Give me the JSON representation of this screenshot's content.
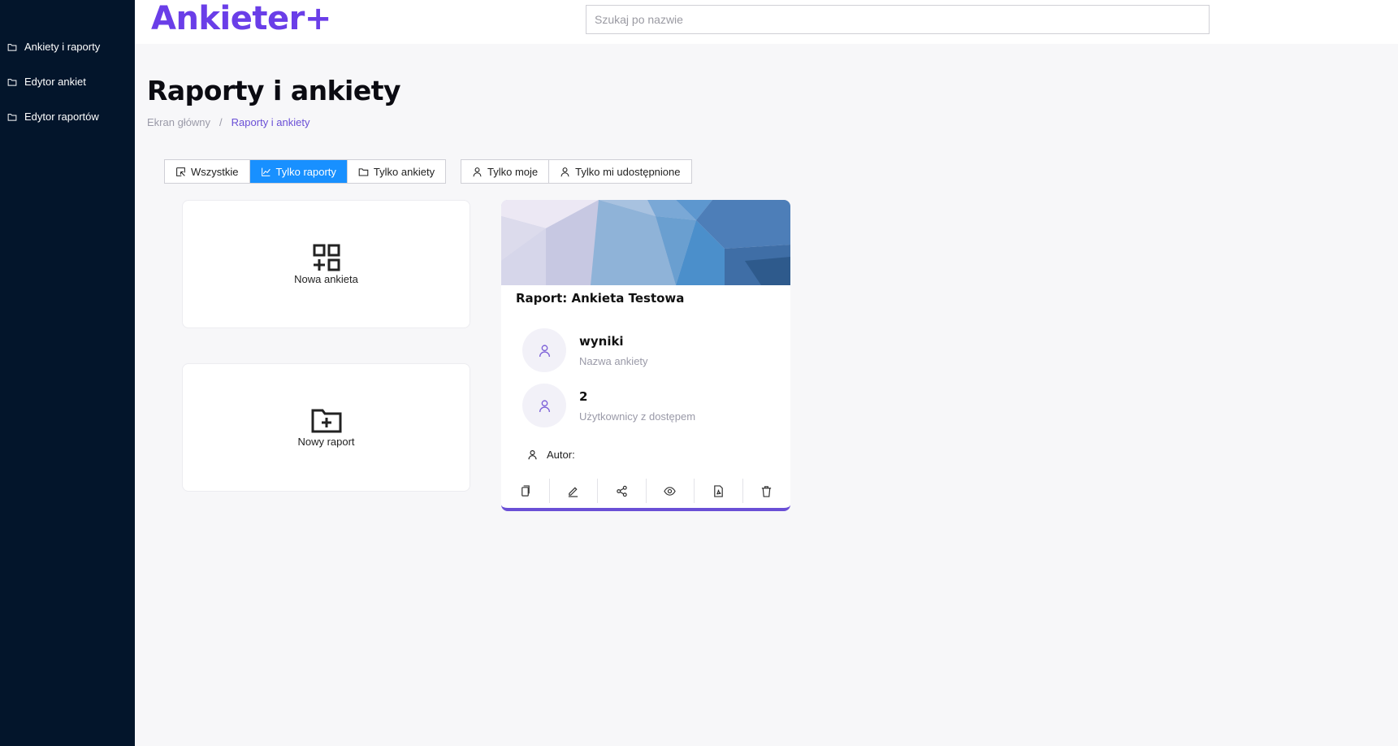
{
  "app": {
    "logo_text": "Ankieter",
    "logo_plus": "+"
  },
  "sidebar": {
    "items": [
      {
        "label": "Ankiety i raporty"
      },
      {
        "label": "Edytor ankiet"
      },
      {
        "label": "Edytor raportów"
      }
    ]
  },
  "search": {
    "placeholder": "Szukaj po nazwie",
    "value": ""
  },
  "page": {
    "title": "Raporty i ankiety",
    "breadcrumb": [
      "Ekran główny",
      "/",
      "Raporty i ankiety"
    ]
  },
  "filters": {
    "type_group": [
      {
        "label": "Wszystkie",
        "icon": "select-all-icon",
        "active": false
      },
      {
        "label": "Tylko raporty",
        "icon": "line-chart-icon",
        "active": true
      },
      {
        "label": "Tylko ankiety",
        "icon": "folder-icon",
        "active": false
      }
    ],
    "owner_group": [
      {
        "label": "Tylko moje",
        "icon": "user-icon"
      },
      {
        "label": "Tylko mi udostępnione",
        "icon": "user-icon"
      }
    ]
  },
  "create": {
    "new_survey_label": "Nowa ankieta",
    "new_report_label": "Nowy raport"
  },
  "report_card": {
    "title": "Raport: Ankieta Testowa",
    "survey_name": "wyniki",
    "survey_name_caption": "Nazwa ankiety",
    "users_count": "2",
    "users_caption": "Użytkownicy z dostępem",
    "author_label": "Autor:",
    "actions": [
      "copy-icon",
      "edit-icon",
      "share-icon",
      "eye-icon",
      "file-pdf-icon",
      "delete-icon"
    ]
  },
  "colors": {
    "sidebar_bg": "#03152b",
    "brand": "#6a3ee8",
    "active_filter": "#1890ff",
    "accent": "#6a4fd6"
  }
}
